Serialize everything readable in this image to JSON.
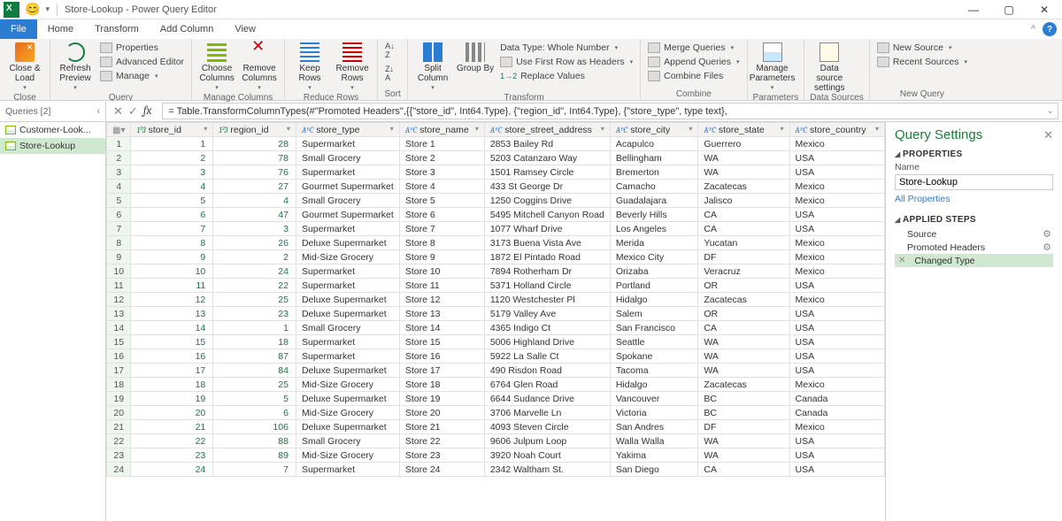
{
  "titlebar": {
    "emoji": "😊",
    "qat_drop": "▾",
    "separator": "|",
    "title": "Store-Lookup - Power Query Editor",
    "win_min": "—",
    "win_max": "▢",
    "win_close": "✕"
  },
  "ribbon_tabs": {
    "file": "File",
    "home": "Home",
    "transform": "Transform",
    "add_column": "Add Column",
    "view": "View",
    "collapse": "^",
    "help": "?"
  },
  "ribbon": {
    "close": {
      "close_load": "Close & Load",
      "dd": "▾",
      "group": "Close"
    },
    "query": {
      "refresh_preview": "Refresh Preview",
      "dd": "▾",
      "properties": "Properties",
      "adv_editor": "Advanced Editor",
      "manage": "Manage",
      "group": "Query"
    },
    "manage_cols": {
      "choose": "Choose Columns",
      "remove": "Remove Columns",
      "dd": "▾",
      "group": "Manage Columns"
    },
    "reduce_rows": {
      "keep": "Keep Rows",
      "remove": "Remove Rows",
      "dd": "▾",
      "group": "Reduce Rows"
    },
    "sort": {
      "asc": "A→Z",
      "desc": "Z→A",
      "group": "Sort"
    },
    "transform": {
      "split": "Split Column",
      "group_by": "Group By",
      "data_type": "Data Type: Whole Number",
      "first_row": "Use First Row as Headers",
      "replace": "Replace Values",
      "dd": "▾",
      "group": "Transform"
    },
    "combine": {
      "merge": "Merge Queries",
      "append": "Append Queries",
      "combine_files": "Combine Files",
      "dd": "▾",
      "group": "Combine"
    },
    "parameters": {
      "manage_params": "Manage Parameters",
      "dd": "▾",
      "group": "Parameters"
    },
    "data_sources": {
      "data_source": "Data source settings",
      "group": "Data Sources"
    },
    "new_query": {
      "new_source": "New Source",
      "recent": "Recent Sources",
      "dd": "▾",
      "group": "New Query"
    }
  },
  "queries_header": {
    "label": "Queries [2]",
    "chev": "‹"
  },
  "fx": {
    "cancel": "✕",
    "commit": "✓",
    "fx": "fx",
    "formula": "= Table.TransformColumnTypes(#\"Promoted Headers\",{{\"store_id\", Int64.Type}, {\"region_id\", Int64.Type}, {\"store_type\", type text},",
    "expand": "⌄"
  },
  "queries": [
    {
      "name": "Customer-Look..."
    },
    {
      "name": "Store-Lookup"
    }
  ],
  "columns": [
    {
      "name": "store_id",
      "type": "num"
    },
    {
      "name": "region_id",
      "type": "num"
    },
    {
      "name": "store_type",
      "type": "txt"
    },
    {
      "name": "store_name",
      "type": "txt"
    },
    {
      "name": "store_street_address",
      "type": "txt"
    },
    {
      "name": "store_city",
      "type": "txt"
    },
    {
      "name": "store_state",
      "type": "txt"
    },
    {
      "name": "store_country",
      "type": "txt"
    }
  ],
  "type_icons": {
    "num": "1²3",
    "txt": "AᴮC"
  },
  "col_dd": "▾",
  "rows": [
    [
      1,
      28,
      "Supermarket",
      "Store 1",
      "2853 Bailey Rd",
      "Acapulco",
      "Guerrero",
      "Mexico"
    ],
    [
      2,
      78,
      "Small Grocery",
      "Store 2",
      "5203 Catanzaro Way",
      "Bellingham",
      "WA",
      "USA"
    ],
    [
      3,
      76,
      "Supermarket",
      "Store 3",
      "1501 Ramsey Circle",
      "Bremerton",
      "WA",
      "USA"
    ],
    [
      4,
      27,
      "Gourmet Supermarket",
      "Store 4",
      "433 St George Dr",
      "Camacho",
      "Zacatecas",
      "Mexico"
    ],
    [
      5,
      4,
      "Small Grocery",
      "Store 5",
      "1250 Coggins Drive",
      "Guadalajara",
      "Jalisco",
      "Mexico"
    ],
    [
      6,
      47,
      "Gourmet Supermarket",
      "Store 6",
      "5495 Mitchell Canyon Road",
      "Beverly Hills",
      "CA",
      "USA"
    ],
    [
      7,
      3,
      "Supermarket",
      "Store 7",
      "1077 Wharf Drive",
      "Los Angeles",
      "CA",
      "USA"
    ],
    [
      8,
      26,
      "Deluxe Supermarket",
      "Store 8",
      "3173 Buena Vista Ave",
      "Merida",
      "Yucatan",
      "Mexico"
    ],
    [
      9,
      2,
      "Mid-Size Grocery",
      "Store 9",
      "1872 El Pintado Road",
      "Mexico City",
      "DF",
      "Mexico"
    ],
    [
      10,
      24,
      "Supermarket",
      "Store 10",
      "7894 Rotherham Dr",
      "Orizaba",
      "Veracruz",
      "Mexico"
    ],
    [
      11,
      22,
      "Supermarket",
      "Store 11",
      "5371 Holland Circle",
      "Portland",
      "OR",
      "USA"
    ],
    [
      12,
      25,
      "Deluxe Supermarket",
      "Store 12",
      "1120 Westchester Pl",
      "Hidalgo",
      "Zacatecas",
      "Mexico"
    ],
    [
      13,
      23,
      "Deluxe Supermarket",
      "Store 13",
      "5179 Valley Ave",
      "Salem",
      "OR",
      "USA"
    ],
    [
      14,
      1,
      "Small Grocery",
      "Store 14",
      "4365 Indigo Ct",
      "San Francisco",
      "CA",
      "USA"
    ],
    [
      15,
      18,
      "Supermarket",
      "Store 15",
      "5006 Highland Drive",
      "Seattle",
      "WA",
      "USA"
    ],
    [
      16,
      87,
      "Supermarket",
      "Store 16",
      "5922 La Salle Ct",
      "Spokane",
      "WA",
      "USA"
    ],
    [
      17,
      84,
      "Deluxe Supermarket",
      "Store 17",
      "490 Risdon Road",
      "Tacoma",
      "WA",
      "USA"
    ],
    [
      18,
      25,
      "Mid-Size Grocery",
      "Store 18",
      "6764 Glen Road",
      "Hidalgo",
      "Zacatecas",
      "Mexico"
    ],
    [
      19,
      5,
      "Deluxe Supermarket",
      "Store 19",
      "6644 Sudance Drive",
      "Vancouver",
      "BC",
      "Canada"
    ],
    [
      20,
      6,
      "Mid-Size Grocery",
      "Store 20",
      "3706 Marvelle Ln",
      "Victoria",
      "BC",
      "Canada"
    ],
    [
      21,
      106,
      "Deluxe Supermarket",
      "Store 21",
      "4093 Steven Circle",
      "San Andres",
      "DF",
      "Mexico"
    ],
    [
      22,
      88,
      "Small Grocery",
      "Store 22",
      "9606 Julpum Loop",
      "Walla Walla",
      "WA",
      "USA"
    ],
    [
      23,
      89,
      "Mid-Size Grocery",
      "Store 23",
      "3920 Noah Court",
      "Yakima",
      "WA",
      "USA"
    ],
    [
      24,
      7,
      "Supermarket",
      "Store 24",
      "2342 Waltham St.",
      "San Diego",
      "CA",
      "USA"
    ]
  ],
  "settings": {
    "title": "Query Settings",
    "close": "✕",
    "props_section": "PROPERTIES",
    "name_label": "Name",
    "name_value": "Store-Lookup",
    "all_props": "All Properties",
    "steps_section": "APPLIED STEPS",
    "gear": "⚙",
    "x": "✕",
    "steps": [
      {
        "label": "Source",
        "gear": true
      },
      {
        "label": "Promoted Headers",
        "gear": true
      },
      {
        "label": "Changed Type",
        "gear": false
      }
    ]
  }
}
